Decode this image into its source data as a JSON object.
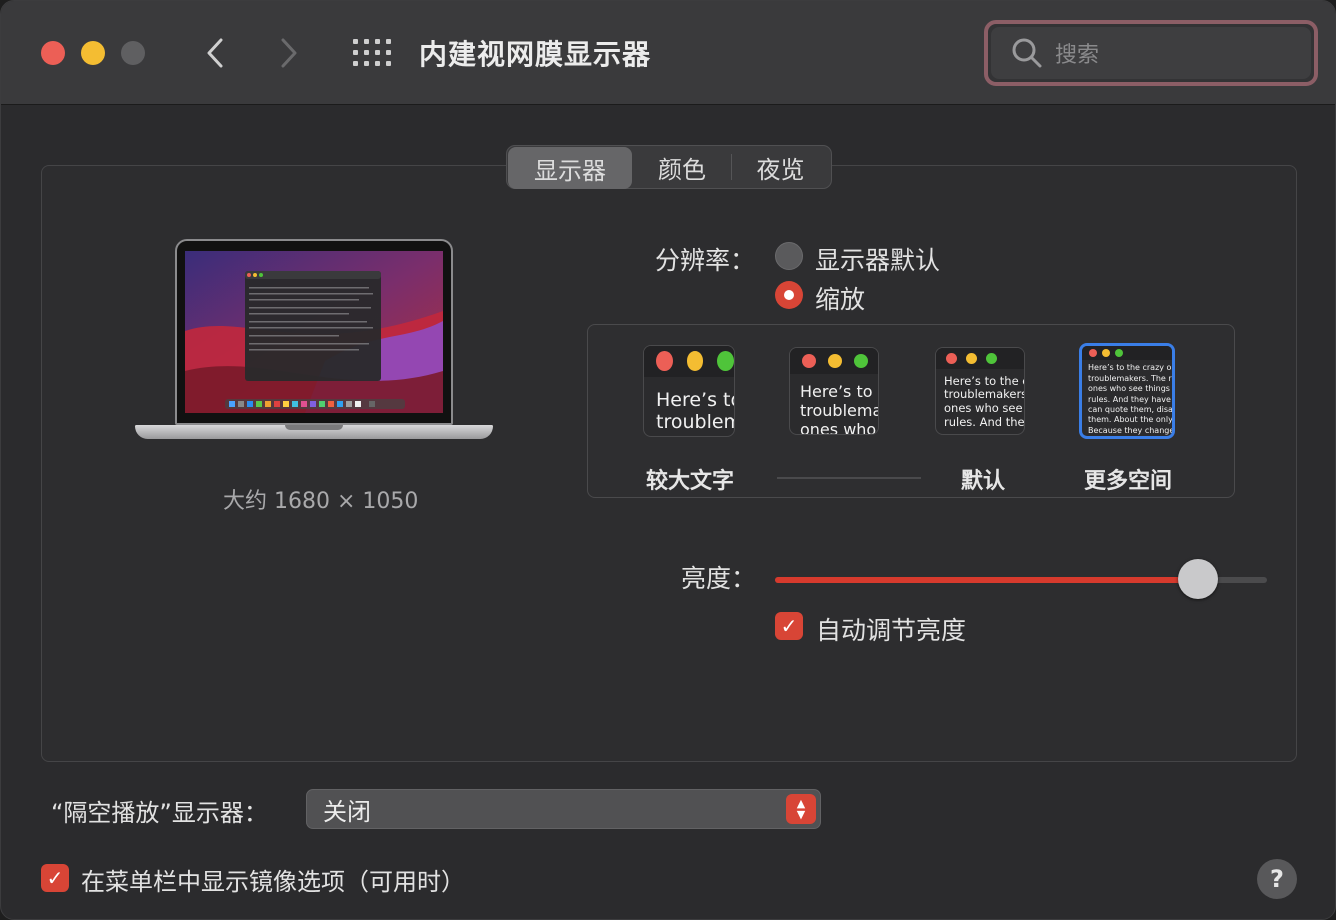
{
  "window": {
    "title": "内建视网膜显示器",
    "search_placeholder": "搜索"
  },
  "tabs": [
    {
      "label": "显示器",
      "selected": true
    },
    {
      "label": "颜色",
      "selected": false
    },
    {
      "label": "夜览",
      "selected": false
    }
  ],
  "display": {
    "caption": "大约 1680 × 1050",
    "resolution_label": "分辨率：",
    "resolution_options": [
      {
        "label": "显示器默认",
        "selected": false
      },
      {
        "label": "缩放",
        "selected": true
      }
    ],
    "scale_options": [
      {
        "label": "较大文字",
        "preview_text": "Here’s to\ntroublem",
        "selected": false
      },
      {
        "label": "",
        "preview_text": "Here’s to t\ntroublema\nones who",
        "selected": false
      },
      {
        "label": "默认",
        "preview_text": "Here’s to the cr\ntroublemakers.\nones who see t\nrules. And they",
        "selected": false
      },
      {
        "label": "更多空间",
        "preview_text": "Here’s to the crazy one\ntroublemakers. The rou\nones who see things dif\nrules. And they have no\ncan quote them, disagre\nthem. About the only th\nBecause they change th",
        "selected": true
      }
    ],
    "brightness_label": "亮度：",
    "brightness_value": 0.86,
    "auto_brightness_label": "自动调节亮度",
    "auto_brightness_checked": true
  },
  "airplay": {
    "label": "“隔空播放”显示器：",
    "value": "关闭"
  },
  "mirror_option": {
    "label": "在菜单栏中显示镜像选项（可用时）",
    "checked": true
  },
  "help_label": "?",
  "colors": {
    "accent": "#d84536",
    "selection": "#3a7ee7"
  }
}
